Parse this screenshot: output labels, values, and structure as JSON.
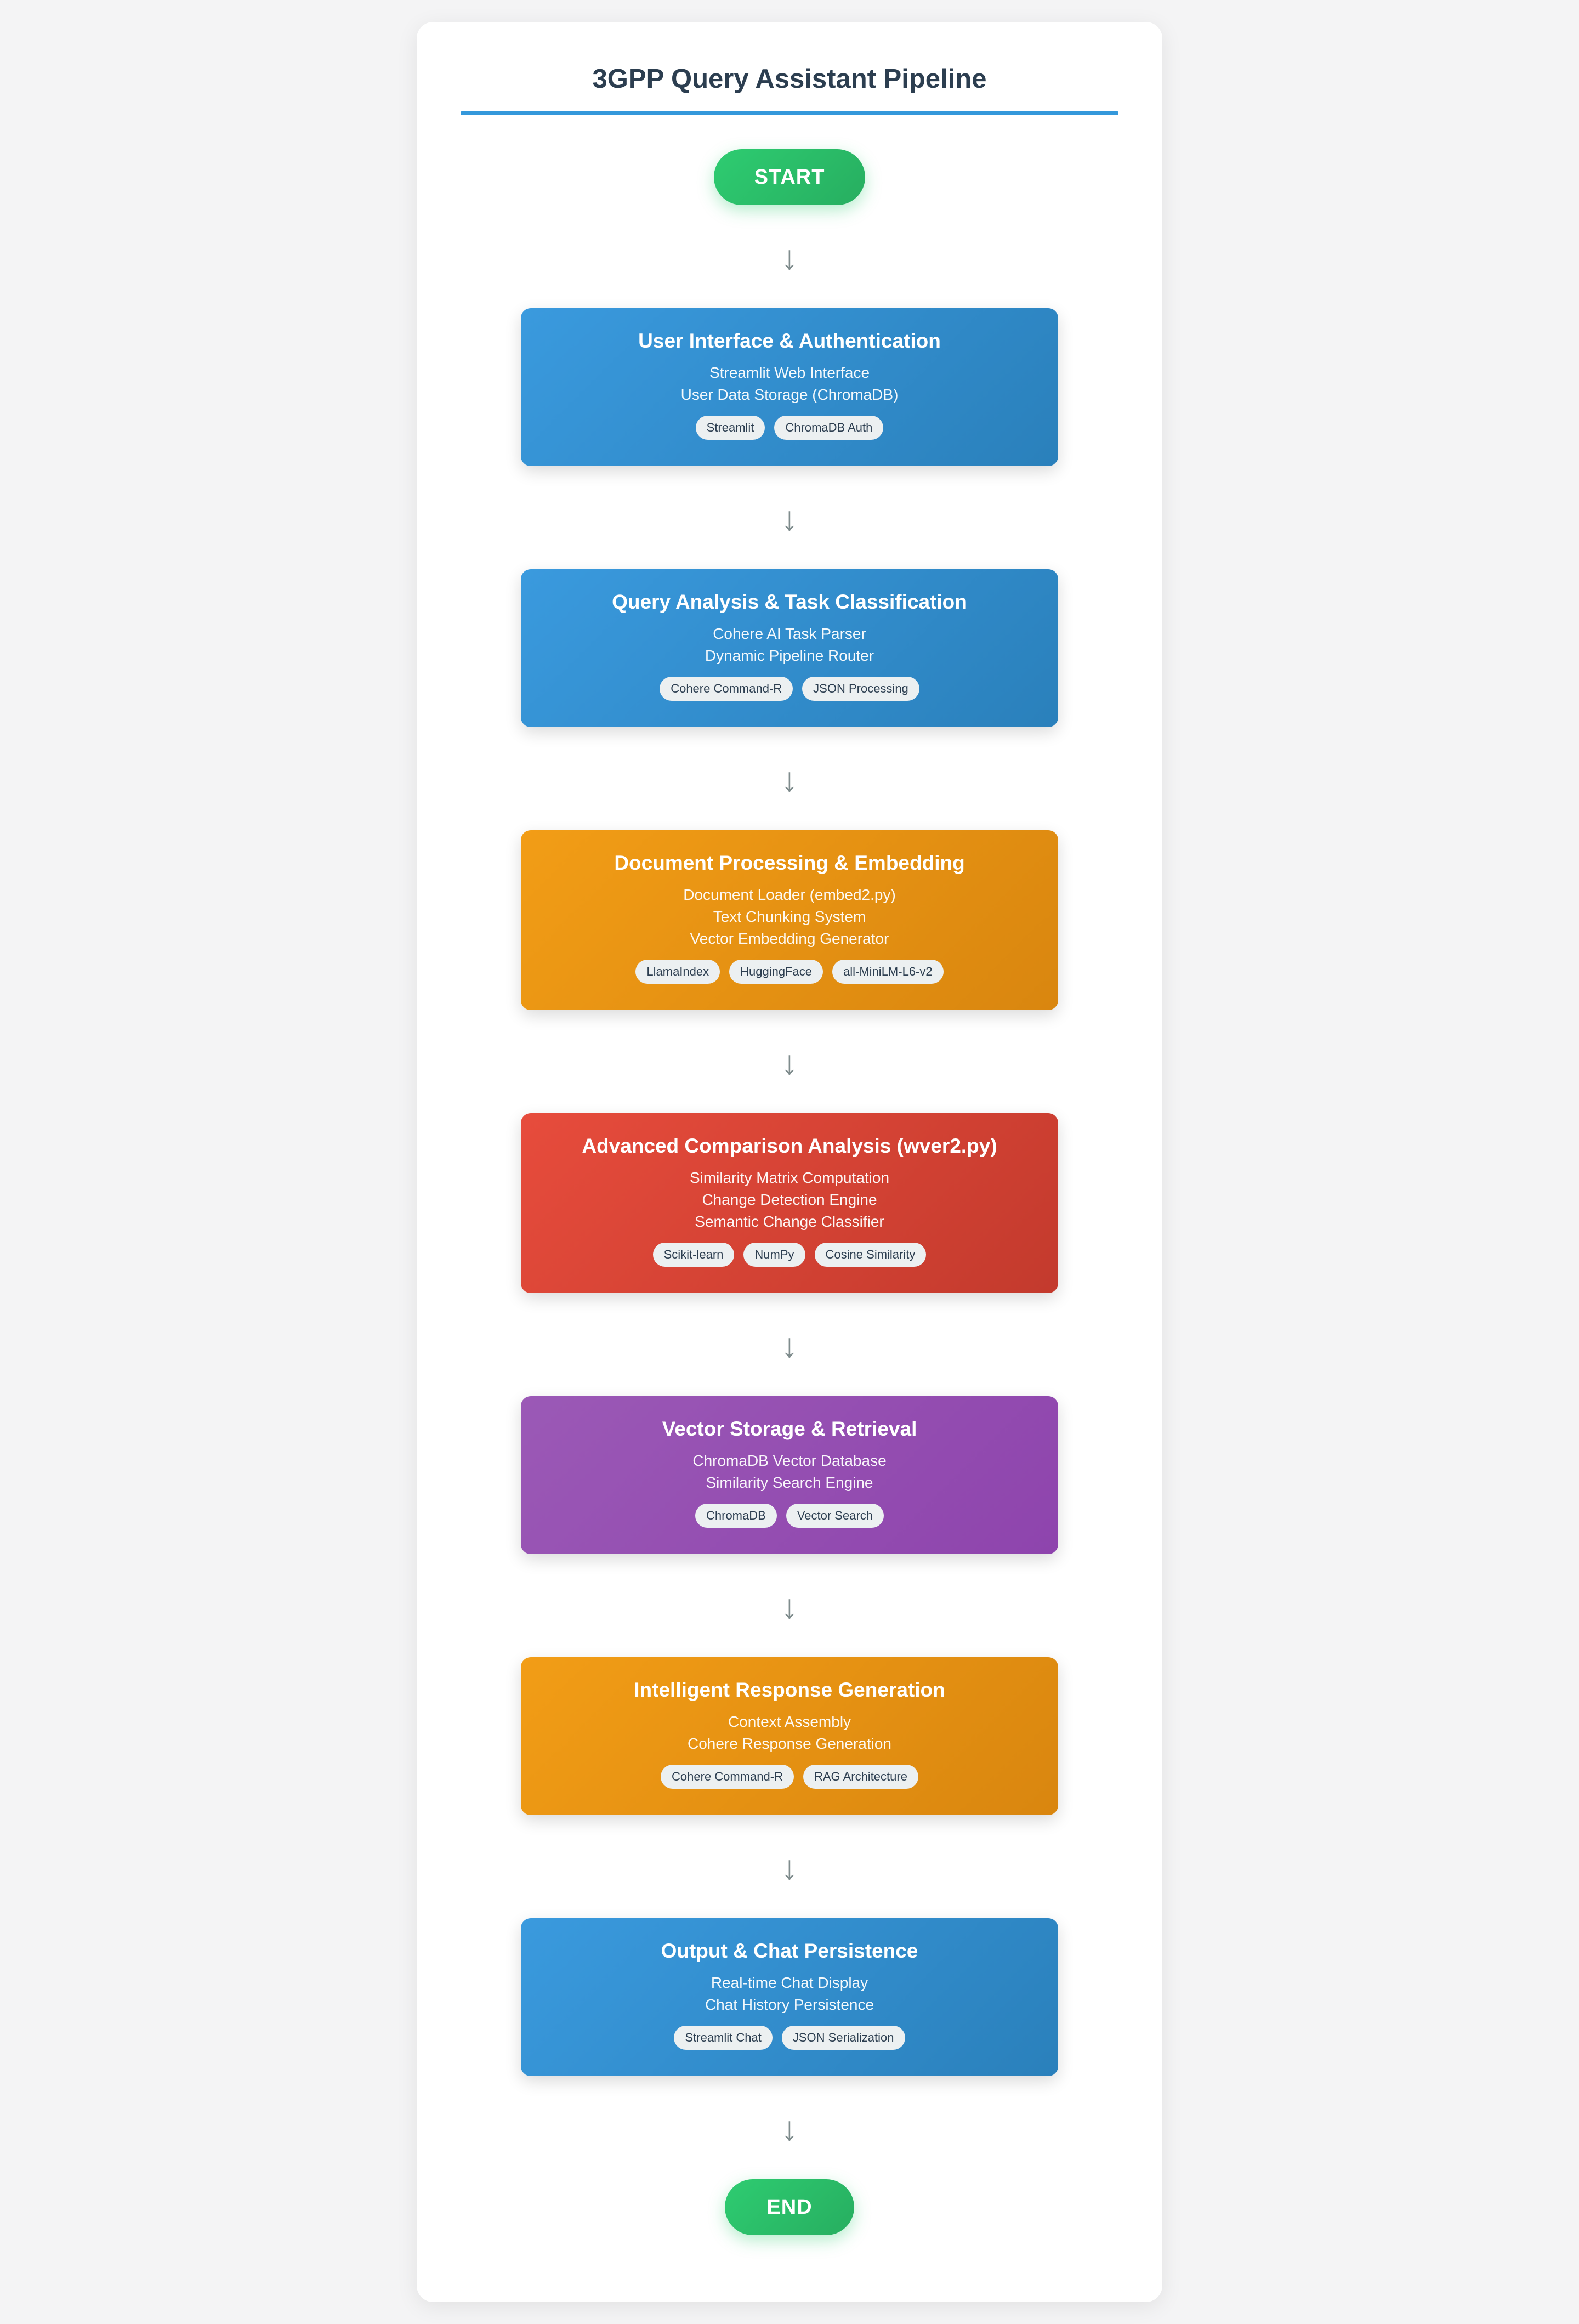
{
  "title": "3GPP Query Assistant Pipeline",
  "start_label": "START",
  "end_label": "END",
  "arrow_glyph": "↓",
  "colors": {
    "accent": "#3498db",
    "terminal": "#2ecc71",
    "blue": "#3498db",
    "orange": "#f39c12",
    "red": "#e74c3c",
    "purple": "#9b59b6"
  },
  "stages": [
    {
      "title": "User Interface & Authentication",
      "color": "blue",
      "lines": [
        "Streamlit Web Interface",
        "User Data Storage (ChromaDB)"
      ],
      "tags": [
        "Streamlit",
        "ChromaDB Auth"
      ]
    },
    {
      "title": "Query Analysis & Task Classification",
      "color": "blue",
      "lines": [
        "Cohere AI Task Parser",
        "Dynamic Pipeline Router"
      ],
      "tags": [
        "Cohere Command-R",
        "JSON Processing"
      ]
    },
    {
      "title": "Document Processing & Embedding",
      "color": "orange",
      "lines": [
        "Document Loader (embed2.py)",
        "Text Chunking System",
        "Vector Embedding Generator"
      ],
      "tags": [
        "LlamaIndex",
        "HuggingFace",
        "all-MiniLM-L6-v2"
      ]
    },
    {
      "title": "Advanced Comparison Analysis (wver2.py)",
      "color": "red",
      "lines": [
        "Similarity Matrix Computation",
        "Change Detection Engine",
        "Semantic Change Classifier"
      ],
      "tags": [
        "Scikit-learn",
        "NumPy",
        "Cosine Similarity"
      ]
    },
    {
      "title": "Vector Storage & Retrieval",
      "color": "purple",
      "lines": [
        "ChromaDB Vector Database",
        "Similarity Search Engine"
      ],
      "tags": [
        "ChromaDB",
        "Vector Search"
      ]
    },
    {
      "title": "Intelligent Response Generation",
      "color": "orange",
      "lines": [
        "Context Assembly",
        "Cohere Response Generation"
      ],
      "tags": [
        "Cohere Command-R",
        "RAG Architecture"
      ]
    },
    {
      "title": "Output & Chat Persistence",
      "color": "blue",
      "lines": [
        "Real-time Chat Display",
        "Chat History Persistence"
      ],
      "tags": [
        "Streamlit Chat",
        "JSON Serialization"
      ]
    }
  ]
}
